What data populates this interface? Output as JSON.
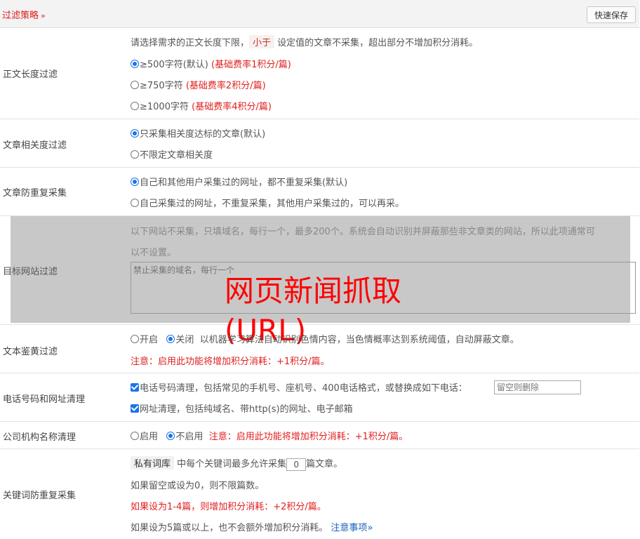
{
  "header": {
    "title": "过滤策略",
    "chevron": "»",
    "quick_save": "快速保存"
  },
  "length_filter": {
    "label": "正文长度过滤",
    "desc_pre": "请选择需求的正文长度下限，",
    "desc_tag": "小于",
    "desc_post": "设定值的文章不采集，超出部分不增加积分消耗。",
    "options": [
      {
        "text": "≥500字符(默认)",
        "note": "(基础费率1积分/篇)",
        "checked": true
      },
      {
        "text": "≥750字符",
        "note": "(基础费率2积分/篇)",
        "checked": false
      },
      {
        "text": "≥1000字符",
        "note": "(基础费率4积分/篇)",
        "checked": false
      }
    ]
  },
  "relevance_filter": {
    "label": "文章相关度过滤",
    "options": [
      {
        "text": "只采集相关度达标的文章(默认)",
        "checked": true
      },
      {
        "text": "不限定文章相关度",
        "checked": false
      }
    ]
  },
  "dedup": {
    "label": "文章防重复采集",
    "options": [
      {
        "text": "自己和其他用户采集过的网址，都不重复采集(默认)",
        "checked": true
      },
      {
        "text": "自己采集过的网址，不重复采集，其他用户采集过的，可以再采。",
        "checked": false
      }
    ]
  },
  "site_filter": {
    "label": "目标网站过滤",
    "desc_line1": "以下网站不采集，只填域名，每行一个，最多200个。系统会自动识别并屏蔽那些非文章类的网站，所以此项通常可",
    "desc_line2": "以不设置。",
    "placeholder": "禁止采集的域名，每行一个"
  },
  "watermark": "网页新闻抓取(URL)",
  "porn_filter": {
    "label": "文本鉴黄过滤",
    "on_label": "开启",
    "off_label": "关闭",
    "desc": "以机器学习算法自动识别色情内容，当色情概率达到系统阈值，自动屏蔽文章。",
    "note": "注意：启用此功能将增加积分消耗：+1积分/篇。"
  },
  "contact_clean": {
    "label": "电话号码和网址清理",
    "phone_text": "电话号码清理，包括常见的手机号、座机号、400电话格式，或替换成如下电话：",
    "phone_placeholder": "留空则删除",
    "url_text": "网址清理，包括纯域名、带http(s)的网址、电子邮箱"
  },
  "org_clean": {
    "label": "公司机构名称清理",
    "enable": "启用",
    "disable": "不启用",
    "note": "注意：启用此功能将增加积分消耗：+1积分/篇。"
  },
  "keyword_dedup": {
    "label": "关键词防重复采集",
    "tag": "私有词库",
    "line1_mid": "中每个关键词最多允许采集",
    "value": "0",
    "line1_post": "篇文章。",
    "line2": "如果留空或设为0，则不限篇数。",
    "line3": "如果设为1-4篇，则增加积分消耗：+2积分/篇。",
    "line4": "如果设为5篇或以上，也不会额外增加积分消耗。",
    "notice_link": "注意事项"
  }
}
